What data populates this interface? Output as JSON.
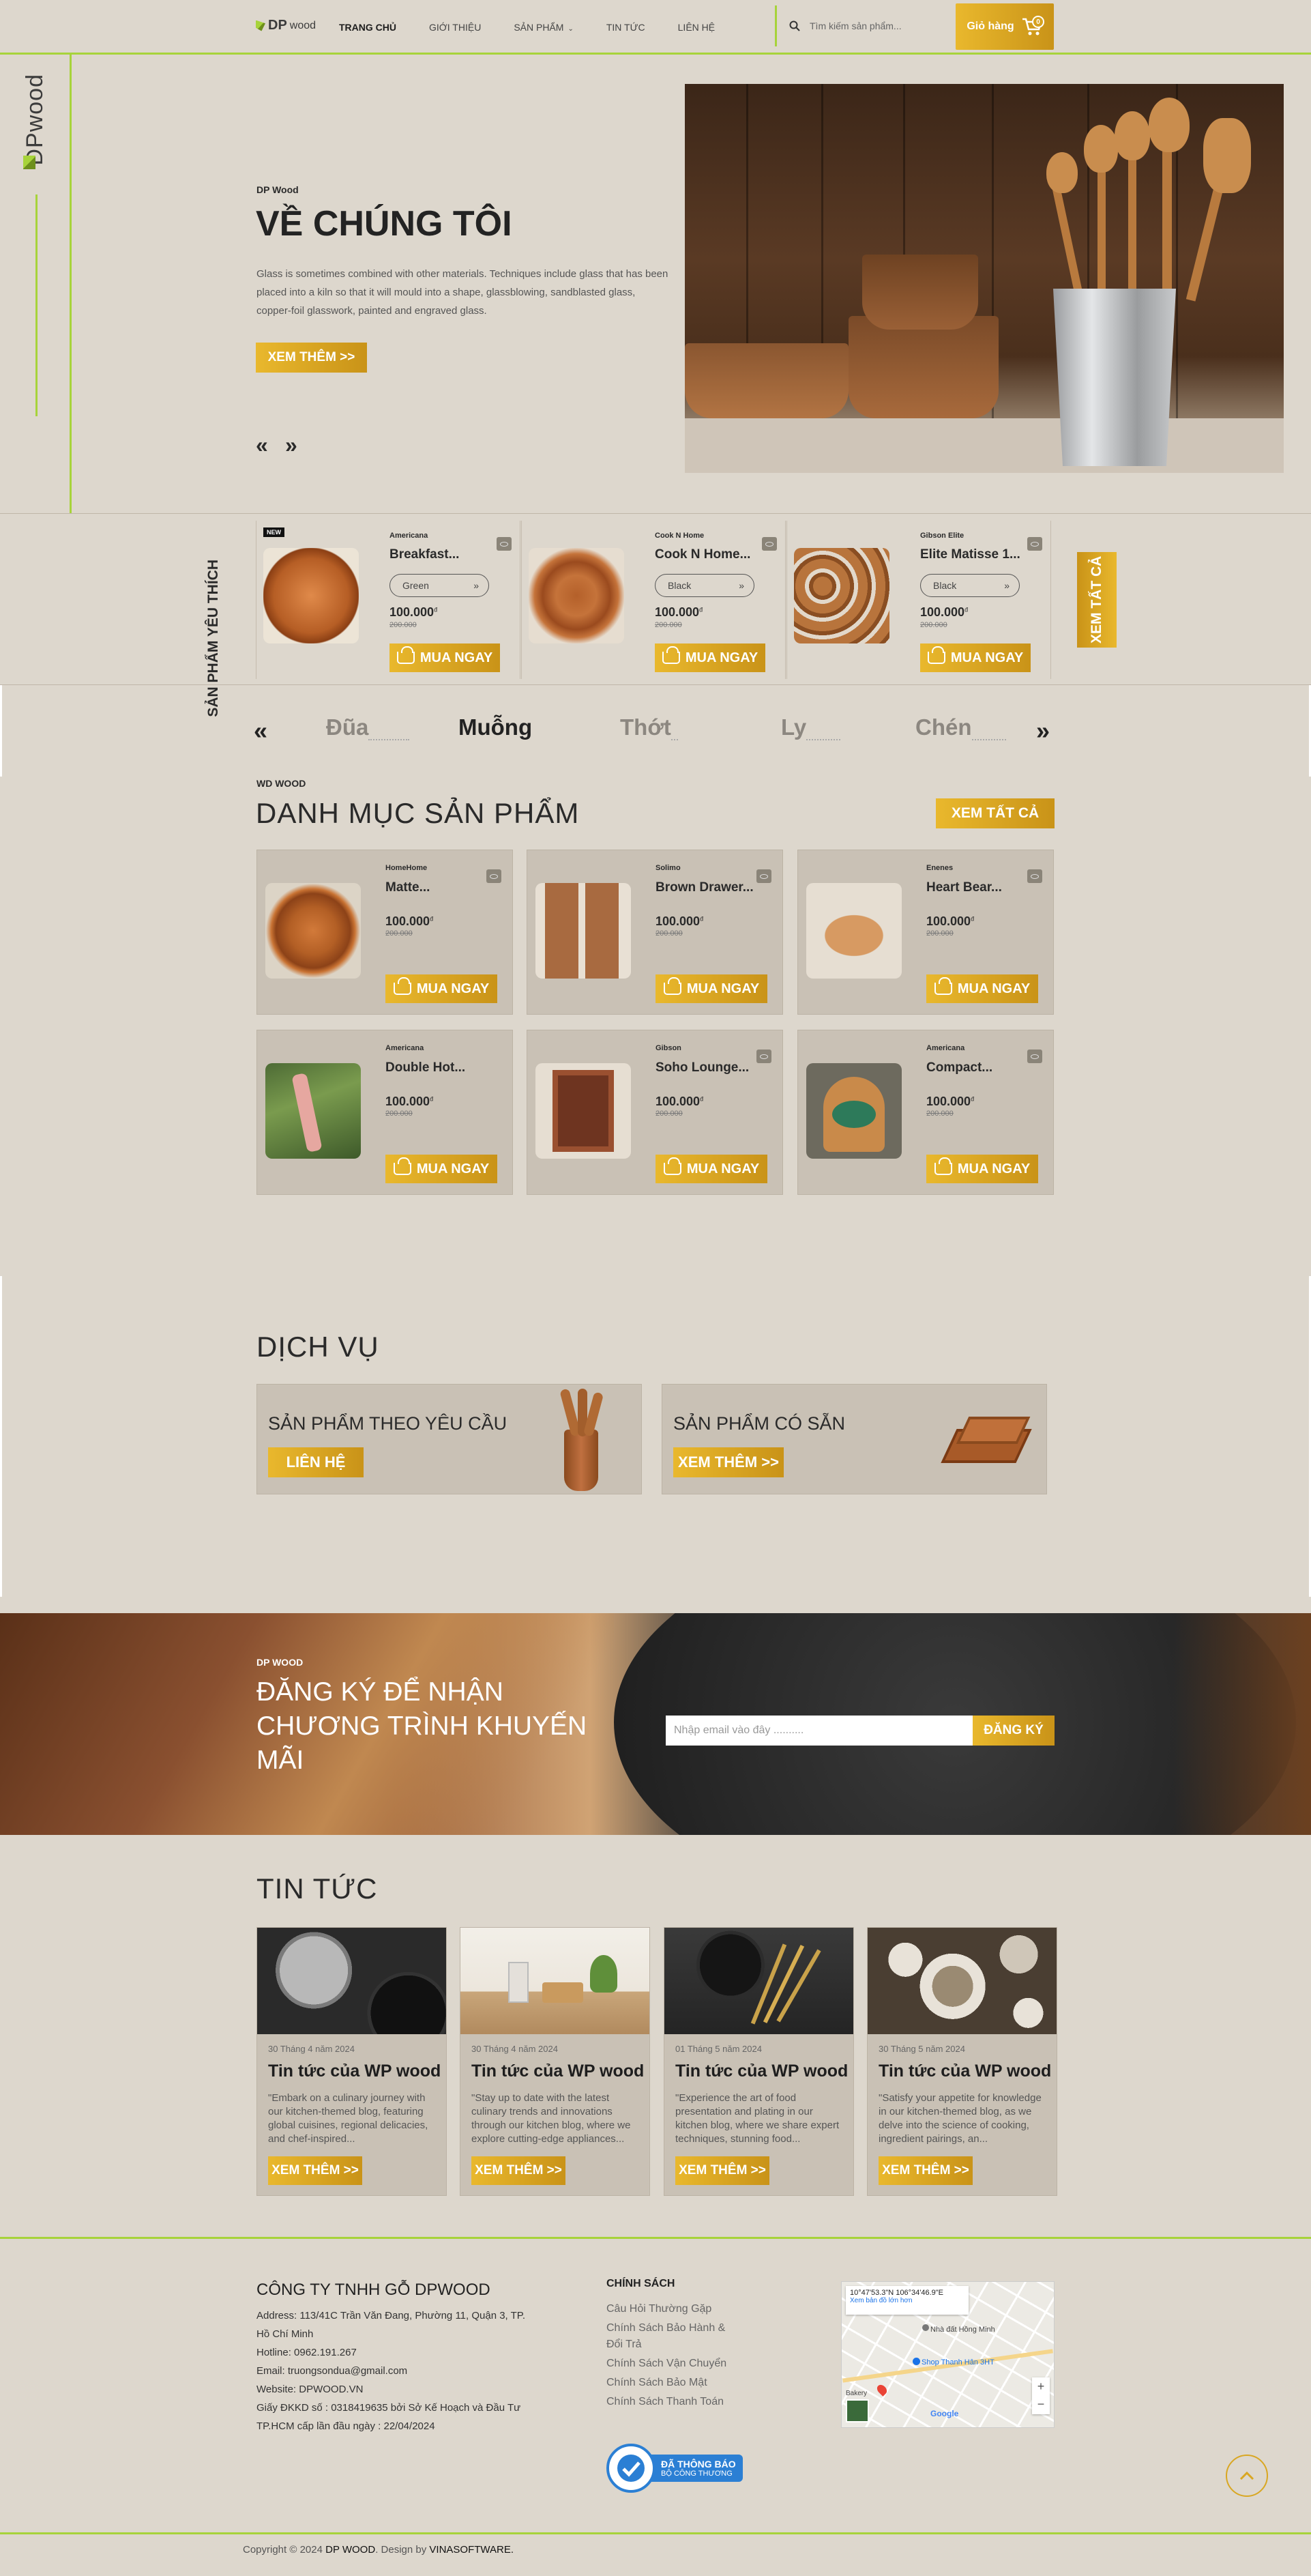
{
  "header": {
    "logo_text": "DP",
    "logo_sub": "wood",
    "nav": [
      "TRANG CHỦ",
      "GIỚI THIỆU",
      "SẢN PHẨM",
      "TIN TỨC",
      "LIÊN HỆ"
    ],
    "search_placeholder": "Tìm kiếm sản phẩm...",
    "cart_label": "Giỏ hàng",
    "cart_count": "0"
  },
  "hero": {
    "eyebrow": "DP Wood",
    "title": "VỀ CHÚNG TÔI",
    "body": "Glass is sometimes combined with other materials. Techniques include glass that has been placed into a kiln so that it will mould into a shape, glassblowing, sandblasted glass, copper-foil glasswork, painted and engraved glass.",
    "button": "XEM THÊM >>",
    "prev": "«",
    "next": "»",
    "side_logo": "DPwood"
  },
  "favorites": {
    "title": "SẢN PHẨM YÊU THÍCH",
    "see_all": "XEM TẤT CẢ",
    "badge_new": "NEW",
    "items": [
      {
        "brand": "Americana",
        "name": "Breakfast...",
        "variant": "Green",
        "price": "100.000",
        "old_price": "200.000",
        "currency": "đ",
        "buy": "MUA NGAY"
      },
      {
        "brand": "Cook N Home",
        "name": "Cook N Home...",
        "variant": "Black",
        "price": "100.000",
        "old_price": "200.000",
        "currency": "đ",
        "buy": "MUA NGAY"
      },
      {
        "brand": "Gibson Elite",
        "name": "Elite Matisse 1...",
        "variant": "Black",
        "price": "100.000",
        "old_price": "200.000",
        "currency": "đ",
        "buy": "MUA NGAY"
      }
    ]
  },
  "category_tabs": {
    "prev": "«",
    "next": "»",
    "tabs": [
      "Đũa",
      "Muỗng",
      "Thớt",
      "Ly",
      "Chén"
    ],
    "active": "Muỗng"
  },
  "catalog": {
    "eyebrow": "WD WOOD",
    "title": "DANH MỤC SẢN PHẨM",
    "see_all": "XEM TẤT CẢ",
    "items": [
      {
        "brand": "HomeHome",
        "name": "Matte...",
        "price": "100.000",
        "old_price": "200.000",
        "currency": "đ",
        "buy": "MUA NGAY"
      },
      {
        "brand": "Solimo",
        "name": "Brown Drawer...",
        "price": "100.000",
        "old_price": "200.000",
        "currency": "đ",
        "buy": "MUA NGAY"
      },
      {
        "brand": "Enenes",
        "name": "Heart Bear...",
        "price": "100.000",
        "old_price": "200.000",
        "currency": "đ",
        "buy": "MUA NGAY"
      },
      {
        "brand": "Americana",
        "name": "Double Hot...",
        "price": "100.000",
        "old_price": "200.000",
        "currency": "đ",
        "buy": "MUA NGAY"
      },
      {
        "brand": "Gibson",
        "name": "Soho Lounge...",
        "price": "100.000",
        "old_price": "200.000",
        "currency": "đ",
        "buy": "MUA NGAY"
      },
      {
        "brand": "Americana",
        "name": "Compact...",
        "price": "100.000",
        "old_price": "200.000",
        "currency": "đ",
        "buy": "MUA NGAY"
      }
    ]
  },
  "services": {
    "title": "DỊCH VỤ",
    "items": [
      {
        "title": "SẢN PHẨM THEO YÊU CẦU",
        "button": "LIÊN HỆ"
      },
      {
        "title": "SẢN PHẨM CÓ SẴN",
        "button": "XEM THÊM >>"
      }
    ]
  },
  "newsletter": {
    "eyebrow": "DP WOOD",
    "title": "ĐĂNG KÝ ĐỂ NHẬN CHƯƠNG TRÌNH KHUYẾN MÃI",
    "placeholder": "Nhập email vào đây ..........",
    "button": "ĐĂNG KÝ"
  },
  "blog": {
    "title": "TIN TỨC",
    "posts": [
      {
        "date": "30 Tháng 4 năm 2024",
        "title": "Tin tức của WP wood",
        "excerpt": "\"Embark on a culinary journey with our kitchen-themed blog, featuring global cuisines, regional delicacies, and chef-inspired...",
        "button": "XEM THÊM >>"
      },
      {
        "date": "30 Tháng 4 năm 2024",
        "title": "Tin tức của WP wood",
        "excerpt": "\"Stay up to date with the latest culinary trends and innovations through our kitchen blog, where we explore cutting-edge appliances...",
        "button": "XEM THÊM >>"
      },
      {
        "date": "01 Tháng 5 năm 2024",
        "title": "Tin tức của WP wood",
        "excerpt": "\"Experience the art of food presentation and plating in our kitchen blog, where we share expert techniques, stunning food...",
        "button": "XEM THÊM >>"
      },
      {
        "date": "30 Tháng 5 năm 2024",
        "title": "Tin tức của WP wood",
        "excerpt": "\"Satisfy your appetite for knowledge in our kitchen-themed blog, as we delve into the science of cooking, ingredient pairings, an...",
        "button": "XEM THÊM >>"
      }
    ]
  },
  "footer": {
    "company": "CÔNG TY TNHH GỖ DPWOOD",
    "address_1": "Address: 113/41C Trần Văn Đang, Phường 11, Quận 3, TP.",
    "address_2": "Hồ Chí Minh",
    "hotline": "Hotline:  0962.191.267",
    "email": "Email: truongsondua@gmail.com",
    "website": "Website: DPWOOD.VN",
    "license_1": "Giấy ĐKKD số : 0318419635 bởi Sở Kế Hoạch và Đầu Tư",
    "license_2": "TP.HCM cấp lần đầu ngày : 22/04/2024",
    "policy_title": "CHÍNH SÁCH",
    "policies": [
      "Câu Hỏi Thường Gặp",
      "Chính Sách Bảo Hành &",
      "Đổi Trả",
      "Chính Sách Vận Chuyển",
      "Chính Sách Bảo Mật",
      "Chính Sách Thanh Toán"
    ],
    "badge_1": "ĐÃ THÔNG BÁO",
    "badge_2": "BỘ CÔNG THƯƠNG",
    "map_coords": "10°47'53.3\"N 106°34'46.9\"E",
    "map_link": "Xem bản đồ lớn hơn",
    "map_place_1": "Nhà đất Hồng Minh",
    "map_place_2": "Shop Thanh Hân 3HT",
    "map_place_3": "Bakery",
    "map_google": "Google",
    "copyright": "Copyright © 2024 ",
    "copyright_brand": "DP WOOD",
    "copyright_mid": ". Design by ",
    "copyright_designer": "VINASOFTWARE."
  },
  "colors": {
    "accent": "#a7d33a",
    "gold": "#d9a722",
    "bg": "#ddd7cd",
    "card": "#c9c1b5"
  }
}
